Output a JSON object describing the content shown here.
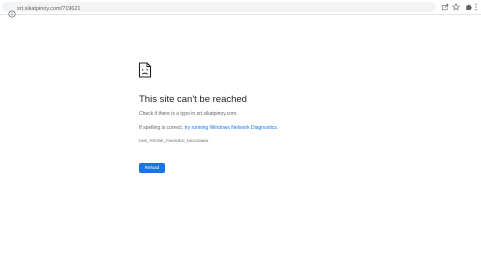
{
  "browser": {
    "url": "srt.sikatpinoy.com/?19621",
    "icons": {
      "site_info": "info-icon",
      "share": "share-icon",
      "bookmark": "star-icon",
      "extensions": "puzzle-icon",
      "menu": "kebab-menu-icon"
    }
  },
  "error": {
    "icon": "sad-document-icon",
    "title": "This site can't be reached",
    "typo_text": "Check if there is a typo in srt.sikatpinoy.com.",
    "spelling_prefix": "If spelling is correct, ",
    "diagnostics_link": "try running Windows Network Diagnostics",
    "spelling_suffix": ".",
    "code": "DNS_PROBE_FINISHED_NXDOMAIN",
    "reload_label": "Reload"
  },
  "colors": {
    "accent": "#1a73e8",
    "title": "#202124",
    "body_text": "#5f6368",
    "omnibox_bg": "#f1f3f4"
  }
}
